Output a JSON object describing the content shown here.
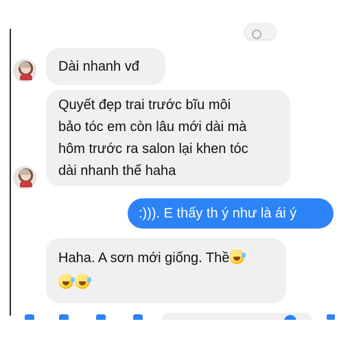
{
  "conversation": {
    "messages": [
      {
        "direction": "incoming",
        "lines": [
          "Dài nhanh vđ"
        ]
      },
      {
        "direction": "incoming",
        "lines": [
          "Quyết đẹp trai trước  bĩu môi",
          "bảo tóc em còn lâu mới dài mà",
          "hôm trước ra salon lại khen tóc",
          "dài nhanh thế haha"
        ]
      },
      {
        "direction": "outgoing",
        "lines": [
          ":))). E thấy th ý như là ái ý"
        ]
      },
      {
        "direction": "incoming",
        "lines": [
          "Haha. A sơn mới giống. Thề"
        ]
      }
    ]
  },
  "icons": {
    "avatar": "contact-avatar",
    "reaction": "smile-reaction-icon",
    "emoji": "rolling-on-floor-laughing-emoji",
    "composer": [
      "plus-icon",
      "camera-icon",
      "image-icon",
      "mic-icon",
      "emoji-icon",
      "like-icon"
    ]
  },
  "colors": {
    "incoming_bubble": "#f0f0f0",
    "outgoing_bubble": "#2c83f6",
    "outgoing_text": "#ffffff",
    "text": "#111111"
  }
}
